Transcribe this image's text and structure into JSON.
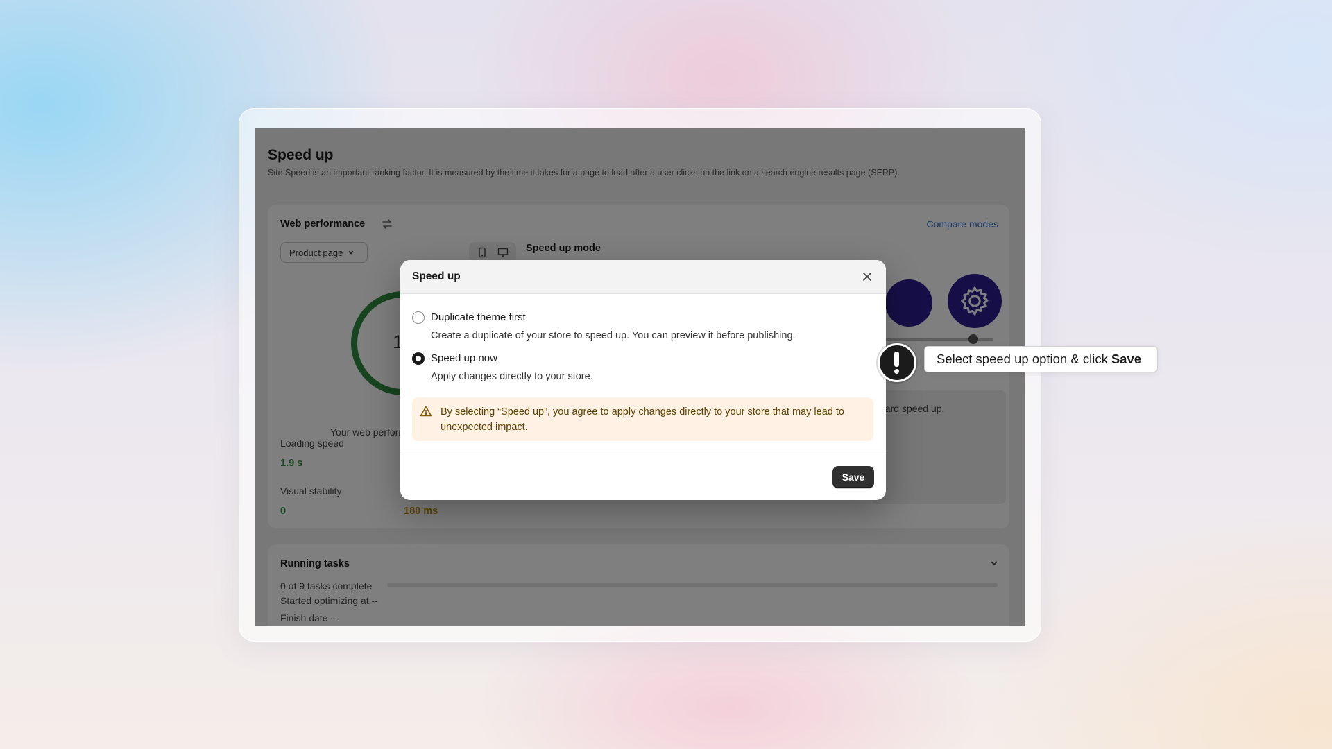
{
  "page": {
    "title": "Speed up",
    "description": "Site Speed is an important ranking factor. It is measured by the time it takes for a page to load after a user clicks on the link on a search engine results page (SERP)."
  },
  "web_performance": {
    "title": "Web performance",
    "compare_link": "Compare modes",
    "page_selector": "Product page",
    "mode_title": "Speed up mode",
    "score_partial": "10",
    "performance_text": "Your web perform",
    "loading_speed_label": "Loading speed",
    "loading_speed_value": "1.9 s",
    "visual_stability_label": "Visual stability",
    "visual_stability_value": "0",
    "interactivity_value": "180 ms",
    "side_note": "dard speed up."
  },
  "running_tasks": {
    "title": "Running tasks",
    "progress_text": "0 of 9 tasks complete",
    "progress_fraction": 0,
    "started": "Started optimizing at --",
    "finish": "Finish date --"
  },
  "modal": {
    "title": "Speed up",
    "options": [
      {
        "label": "Duplicate theme first",
        "description": "Create a duplicate of your store to speed up. You can preview it before publishing.",
        "selected": false
      },
      {
        "label": "Speed up now",
        "description": "Apply changes directly to your store.",
        "selected": true
      }
    ],
    "warning": "By selecting “Speed up”, you agree to apply changes directly to your store that may lead to unexpected impact.",
    "save_label": "Save"
  },
  "hint": {
    "text": "Select speed up option & click",
    "emphasis": "Save"
  },
  "colors": {
    "accent_purple": "#2c1f8f",
    "good_green": "#2e8b3e",
    "warning_amber": "#b98900",
    "warning_bg": "#fff1e3",
    "primary_button": "#303030"
  }
}
